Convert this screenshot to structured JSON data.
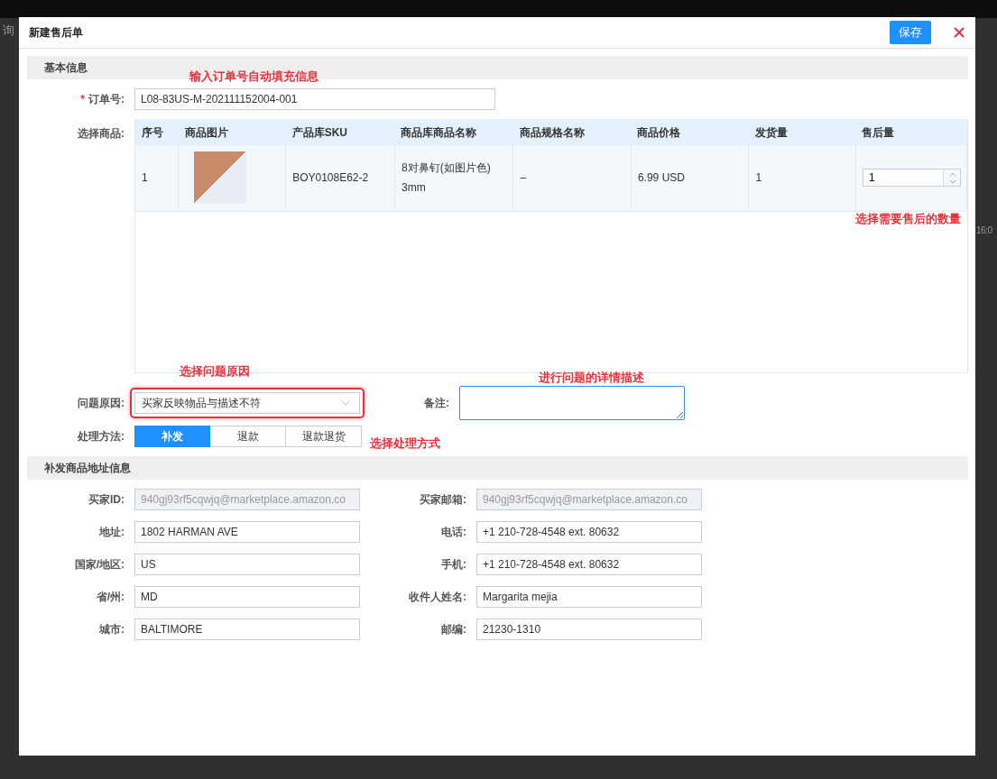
{
  "background": {
    "tab": "询",
    "time": "16:0"
  },
  "dialog": {
    "title": "新建售后单",
    "save": "保存"
  },
  "basic": {
    "heading": "基本信息",
    "annotation": "输入订单号自动填充信息",
    "order": {
      "label": "订单号:",
      "required_mark": "*",
      "value": "L08-83US-M-202111152004-001"
    },
    "goods_label": "选择商品:",
    "table": {
      "columns": [
        "序号",
        "商品图片",
        "产品库SKU",
        "商品库商品名称",
        "商品规格名称",
        "商品价格",
        "发货量",
        "售后量"
      ],
      "rows": [
        {
          "index": "1",
          "sku": "BOY0108E62-2",
          "name": "8对鼻钉(如图片色) 3mm",
          "spec": "–",
          "price": "6.99 USD",
          "shipped": "1",
          "qty": "1"
        }
      ],
      "annotation": "选择需要售后的数量"
    },
    "reason": {
      "label": "问题原因:",
      "value": "买家反映物品与描述不符",
      "annotation": "选择问题原因"
    },
    "remark": {
      "label": "备注:",
      "annotation": "进行问题的详情描述"
    },
    "method": {
      "label": "处理方法:",
      "annotation": "选择处理方式",
      "options": [
        {
          "label": "补发",
          "selected": true
        },
        {
          "label": "退款",
          "selected": false
        },
        {
          "label": "退款退货",
          "selected": false
        }
      ]
    }
  },
  "address": {
    "heading": "补发商品地址信息",
    "rows": [
      [
        {
          "label": "买家ID:",
          "value": "940gj93rf5cqwjq@marketplace.amazon.co",
          "disabled": true
        },
        {
          "label": "买家邮箱:",
          "value": "940gj93rf5cqwjq@marketplace.amazon.co",
          "disabled": true
        }
      ],
      [
        {
          "label": "地址:",
          "value": "1802 HARMAN AVE",
          "disabled": false
        },
        {
          "label": "电话:",
          "value": "+1 210-728-4548 ext. 80632",
          "disabled": false
        }
      ],
      [
        {
          "label": "国家/地区:",
          "value": "US",
          "disabled": false
        },
        {
          "label": "手机:",
          "value": "+1 210-728-4548 ext. 80632",
          "disabled": false
        }
      ],
      [
        {
          "label": "省/州:",
          "value": "MD",
          "disabled": false
        },
        {
          "label": "收件人姓名:",
          "value": "Margarita mejia",
          "disabled": false
        }
      ],
      [
        {
          "label": "城市:",
          "value": "BALTIMORE",
          "disabled": false
        },
        {
          "label": "邮编:",
          "value": "21230-1310",
          "disabled": false
        }
      ]
    ]
  }
}
